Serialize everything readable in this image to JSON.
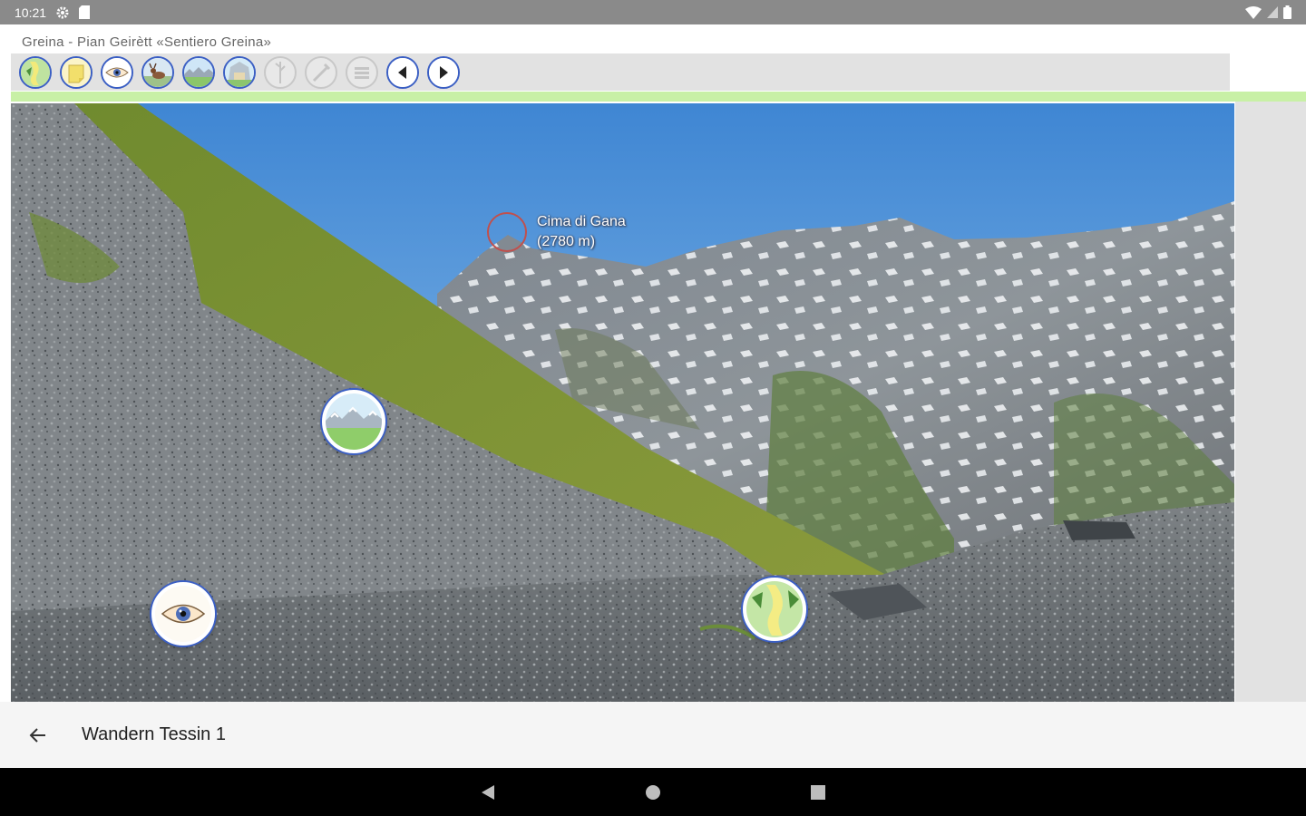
{
  "status_bar": {
    "time": "10:21",
    "icons": [
      "settings-icon",
      "sd-card-icon",
      "wifi-icon",
      "signal-icon",
      "battery-icon"
    ]
  },
  "app": {
    "title": "Greina - Pian Geirètt «Sentiero Greina»"
  },
  "toolbar": {
    "buttons": [
      {
        "name": "path-map-icon",
        "enabled": true
      },
      {
        "name": "note-icon",
        "enabled": true
      },
      {
        "name": "eye-icon",
        "enabled": true
      },
      {
        "name": "animal-icon",
        "enabled": true
      },
      {
        "name": "landscape-icon",
        "enabled": true
      },
      {
        "name": "village-icon",
        "enabled": true
      },
      {
        "name": "tree-icon",
        "enabled": false
      },
      {
        "name": "tool-icon",
        "enabled": false
      },
      {
        "name": "list-icon",
        "enabled": false
      },
      {
        "name": "previous-icon",
        "enabled": true
      },
      {
        "name": "next-icon",
        "enabled": true
      }
    ]
  },
  "panorama": {
    "peak_name": "Cima di Gana",
    "peak_elevation": "(2780 m)"
  },
  "bottom_bar": {
    "title": "Wandern Tessin 1"
  },
  "colors": {
    "accent": "#3b5fc4",
    "toolbar_bg": "#e2e2e2",
    "strip_green": "#c8f0a6",
    "peak_marker": "#c0504d"
  }
}
